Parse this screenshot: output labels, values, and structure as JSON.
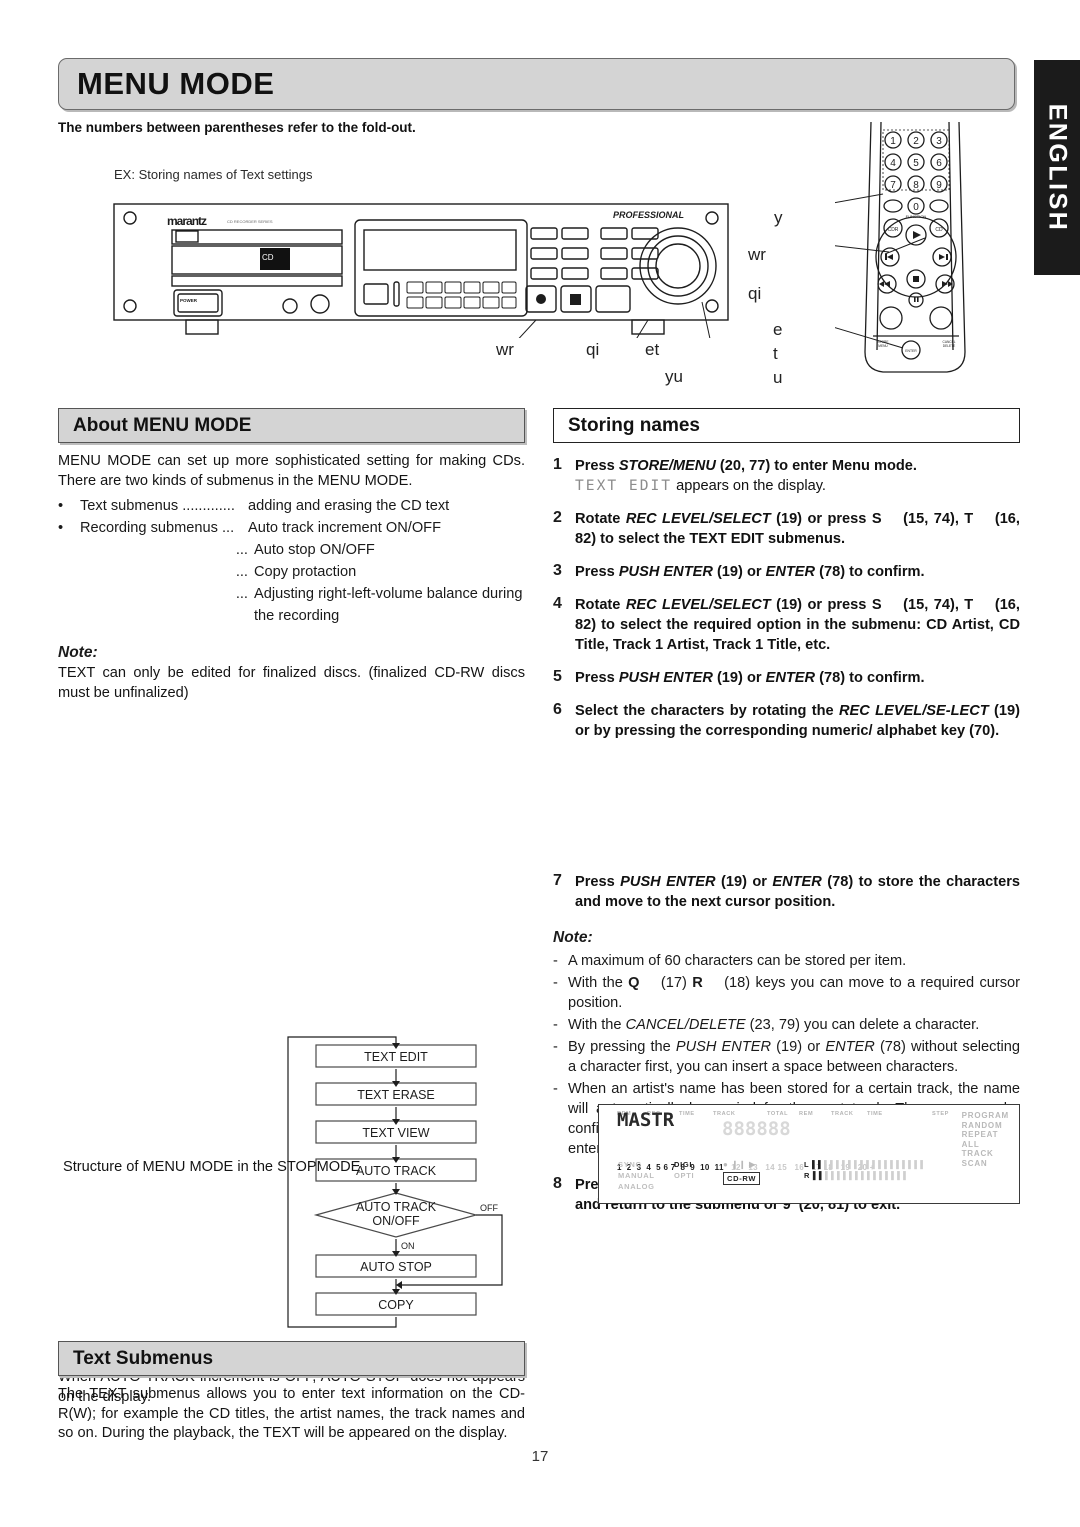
{
  "header": {
    "title": "MENU MODE",
    "subtitle": "The numbers between parentheses refer to the fold-out.",
    "example_label": "EX: Storing names of Text settings",
    "language_tab": "ENGLISH"
  },
  "illustration": {
    "brand": "marantz",
    "brand_sub": "CD RECORDER SERIES",
    "professional_badge": "PROFESSIONAL",
    "power_label": "POWER",
    "bottom_callouts": [
      "wr",
      "qi",
      "et",
      "yu"
    ],
    "remote_callouts": [
      "y",
      "wr",
      "qi",
      "e",
      "t",
      "u"
    ],
    "remote_keys": [
      "1",
      "2",
      "3",
      "4",
      "5",
      "6",
      "7",
      "8",
      "9",
      "0"
    ],
    "remote_function_label": "FUNCTION",
    "remote_cdr": "CDR",
    "remote_cd": "CD",
    "remote_enter": "ENTER",
    "remote_store": "STORE/MENU",
    "remote_cancel": "CANCEL/DELETE"
  },
  "about": {
    "heading": "About MENU MODE",
    "intro": "MENU MODE can set up more sophisticated setting for making CDs. There are two kinds of submenus in the MENU MODE.",
    "bullets": [
      {
        "key": "Text submenus .............",
        "value": "adding and erasing the CD text"
      },
      {
        "key": "Recording submenus ...",
        "value": "Auto track increment ON/OFF"
      }
    ],
    "continued": [
      {
        "key": "...",
        "value": "Auto stop ON/OFF"
      },
      {
        "key": "...",
        "value": "Copy protaction"
      },
      {
        "key": "...",
        "value": "Adjusting right-left-volume balance during the recording"
      }
    ],
    "note_heading": "Note:",
    "note_text": "TEXT can only be edited for finalized discs. (finalized CD-RW discs must be unfinalized)"
  },
  "flowchart": {
    "caption": "Structure of MENU MODE in the STOPMODE",
    "boxes": [
      "TEXT EDIT",
      "TEXT ERASE",
      "TEXT VIEW",
      "AUTO TRACK"
    ],
    "decision": "AUTO TRACK ON/OFF",
    "decision_yes": "ON",
    "decision_no": "OFF",
    "after": [
      "AUTO STOP",
      "COPY"
    ]
  },
  "auto_track_note": {
    "heading": "Note:",
    "text": "When AUTO TRACK increment is OFF, AUTO STOP does not appears on the display."
  },
  "text_submenus": {
    "heading": "Text Submenus",
    "text": "The TEXT submenus allows you to enter text information on the CD-R(W); for example the CD titles, the artist names, the track names and so on. During the playback, the TEXT will be appeared on the display."
  },
  "storing": {
    "heading": "Storing names",
    "steps": [
      {
        "n": "1",
        "html": "Press <i>STORE/MENU</i> (20, 77) to enter Menu mode.",
        "sub_prefix": "TEXT  EDIT",
        "sub_suffix": "appears on the display."
      },
      {
        "n": "2",
        "html": "Rotate <i>REC LEVEL/SELECT</i> (19) or press <b>S</b>&nbsp;&nbsp;&nbsp;&nbsp;(15, 74), <b>T</b>&nbsp;&nbsp;&nbsp;&nbsp;(16, 82) to select the TEXT EDIT submenus."
      },
      {
        "n": "3",
        "html": "Press <i>PUSH ENTER</i> (19) or <i>ENTER</i> (78) to confirm."
      },
      {
        "n": "4",
        "html": "Rotate <i>REC LEVEL/SELECT</i> (19) or press <b>S</b>&nbsp;&nbsp;&nbsp;&nbsp;(15, 74), <b>T</b>&nbsp;&nbsp;&nbsp;&nbsp;(16, 82) to select the required option in the submenu: CD Artist, CD Title, Track 1 Artist, Track 1 Title, etc."
      },
      {
        "n": "5",
        "html": "Press <i>PUSH ENTER</i> (19) or <i>ENTER</i> (78) to confirm."
      },
      {
        "n": "6",
        "html": "Select the characters by rotating the <i>REC LEVEL/SE-LECT</i> (19) or by pressing the corresponding numeric/ alphabet key (70)."
      },
      {
        "n": "7",
        "html": "Press <i>PUSH ENTER</i> (19) or <i>ENTER</i> (78) to store the characters and move to the next cursor position."
      },
      {
        "n": "8",
        "html": "Press <i>STORE/MENU</i> (20, 77) to store a name you have entered and return to the submenu or <b>9</b>&nbsp;&nbsp;(20, 81) to exit."
      }
    ],
    "note_heading": "Note:",
    "notes": [
      "A maximum of 60 characters can be stored per item.",
      "With the <b>Q</b>&nbsp;&nbsp;&nbsp;&nbsp;(17) <b>R</b>&nbsp;&nbsp;&nbsp;&nbsp;(18) keys you can move to a required cursor position.",
      "With the <i>CANCEL/DELETE</i> (23, 79) you can delete a character.",
      "By pressing the <i>PUSH ENTER</i> (19) or <i>ENTER</i> (78) without selecting a character first, you can insert a space between characters.",
      "When an artist's name has been stored for a certain track, the name will automatically be copied for the next track. The name can be confirmed by pressing <i>STORE/MENU</i> (20, 77) or a new name can be entered as described above."
    ]
  },
  "lcd": {
    "text": "MASTR",
    "top_labels": [
      "REM",
      "REC",
      "TIME",
      "TRACK",
      "TOTAL",
      "REM",
      "TRACK",
      "TIME",
      "STEP"
    ],
    "track_numbers": [
      "1",
      "2",
      "3",
      "4",
      "5",
      "6",
      "7",
      "8",
      "9",
      "10",
      "11",
      "12",
      "13",
      "14",
      "15",
      "16",
      "17",
      "18",
      "19",
      "20 +"
    ],
    "right_labels": [
      "PROGRAM",
      "RANDOM",
      "REPEAT",
      "ALL",
      "TRACK",
      "SCAN"
    ],
    "bottom_left": [
      "SYNC",
      "MANUAL",
      "ANALOG"
    ],
    "bottom_mid": [
      "DIGI",
      "OPTI"
    ],
    "disc_badge": "CD-RW",
    "channels": [
      "L",
      "R"
    ]
  },
  "page_number": "17"
}
